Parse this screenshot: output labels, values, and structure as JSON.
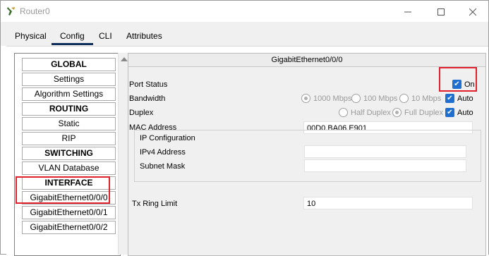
{
  "window": {
    "title": "Router0"
  },
  "tabs": [
    {
      "label": "Physical",
      "active": false
    },
    {
      "label": "Config",
      "active": true
    },
    {
      "label": "CLI",
      "active": false
    },
    {
      "label": "Attributes",
      "active": false
    }
  ],
  "nav": {
    "items": [
      {
        "label": "GLOBAL",
        "header": true
      },
      {
        "label": "Settings",
        "header": false
      },
      {
        "label": "Algorithm Settings",
        "header": false
      },
      {
        "label": "ROUTING",
        "header": true
      },
      {
        "label": "Static",
        "header": false
      },
      {
        "label": "RIP",
        "header": false
      },
      {
        "label": "SWITCHING",
        "header": true
      },
      {
        "label": "VLAN Database",
        "header": false
      },
      {
        "label": "INTERFACE",
        "header": true
      },
      {
        "label": "GigabitEthernet0/0/0",
        "header": false
      },
      {
        "label": "GigabitEthernet0/0/1",
        "header": false
      },
      {
        "label": "GigabitEthernet0/0/2",
        "header": false
      }
    ]
  },
  "panel": {
    "title": "GigabitEthernet0/0/0",
    "port_status_label": "Port Status",
    "port_on_label": "On",
    "port_on_checked": true,
    "bandwidth_label": "Bandwidth",
    "bandwidth_options": [
      "1000 Mbps",
      "100 Mbps",
      "10 Mbps"
    ],
    "bandwidth_auto_label": "Auto",
    "duplex_label": "Duplex",
    "duplex_options": [
      "Half Duplex",
      "Full Duplex"
    ],
    "duplex_auto_label": "Auto",
    "mac_label": "MAC Address",
    "mac_value": "00D0.BA06.E901",
    "ip_config_title": "IP Configuration",
    "ipv4_label": "IPv4 Address",
    "ipv4_value": "",
    "subnet_label": "Subnet Mask",
    "subnet_value": "",
    "tx_ring_label": "Tx Ring Limit",
    "tx_ring_value": "10"
  },
  "colors": {
    "highlight": "#e0202a",
    "checkbox": "#1f6fd0",
    "active_tab_underline": "#0e2e5b"
  }
}
